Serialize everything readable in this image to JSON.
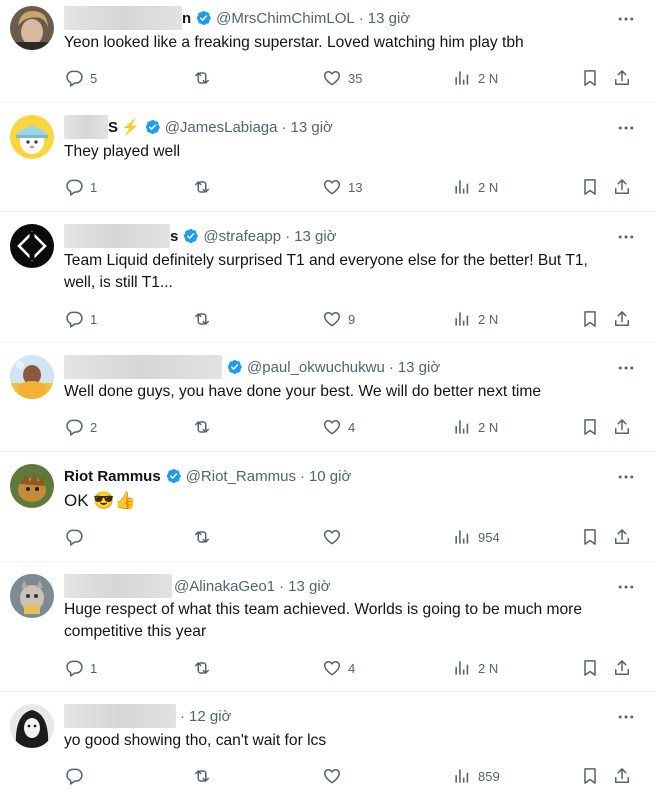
{
  "tweets": [
    {
      "name_fragment": "n",
      "verified": true,
      "handle": "@MrsChimChimLOL",
      "time": "13 giờ",
      "text_lines": [
        "Yeon looked like a freaking superstar. Loved watching him play tbh"
      ],
      "replies": "5",
      "retweets": "",
      "likes": "35",
      "views": "2 N"
    },
    {
      "name_fragment": "S",
      "badge_emoji": "⚡",
      "verified": true,
      "handle": "@JamesLabiaga",
      "time": "13 giờ",
      "text_lines": [
        "They played well"
      ],
      "replies": "1",
      "retweets": "",
      "likes": "13",
      "views": "2 N"
    },
    {
      "name_fragment": "s",
      "verified": true,
      "handle": "@strafeapp",
      "time": "13 giờ",
      "text_lines": [
        "Team Liquid definitely surprised T1 and everyone else for the better! But T1,",
        "well, is still T1..."
      ],
      "replies": "1",
      "retweets": "",
      "likes": "9",
      "views": "2 N"
    },
    {
      "name_fragment": "",
      "verified": true,
      "handle": "@paul_okwuchukwu",
      "time": "13 giờ",
      "text_lines": [
        "Well done guys, you have done your best. We will do better next time"
      ],
      "replies": "2",
      "retweets": "",
      "likes": "4",
      "views": "2 N"
    },
    {
      "name": "Riot Rammus",
      "verified": true,
      "handle": "@Riot_Rammus",
      "time": "10 giờ",
      "text_lines": [
        "OK 😎👍"
      ],
      "replies": "",
      "retweets": "",
      "likes": "",
      "views": "954"
    },
    {
      "name_fragment": "",
      "verified": false,
      "handle": "@AlinakaGeo1",
      "time": "13 giờ",
      "text_lines": [
        "Huge respect of what this team achieved. Worlds is going to be much more",
        "competitive this year"
      ],
      "replies": "1",
      "retweets": "",
      "likes": "4",
      "views": "2 N"
    },
    {
      "name_fragment": "",
      "verified": false,
      "handle": "",
      "time": "12 giờ",
      "text_lines": [
        "yo good showing tho, can't wait for lcs"
      ],
      "replies": "",
      "retweets": "",
      "likes": "",
      "views": "859"
    }
  ],
  "colors": {
    "verified_blue": "#1d9bf0",
    "secondary_text": "#536471",
    "primary_text": "#0f1419",
    "divider": "#eff3f4"
  },
  "icons": [
    "reply-icon",
    "retweet-icon",
    "like-icon",
    "views-icon",
    "bookmark-icon",
    "share-icon",
    "more-icon",
    "verified-icon"
  ]
}
